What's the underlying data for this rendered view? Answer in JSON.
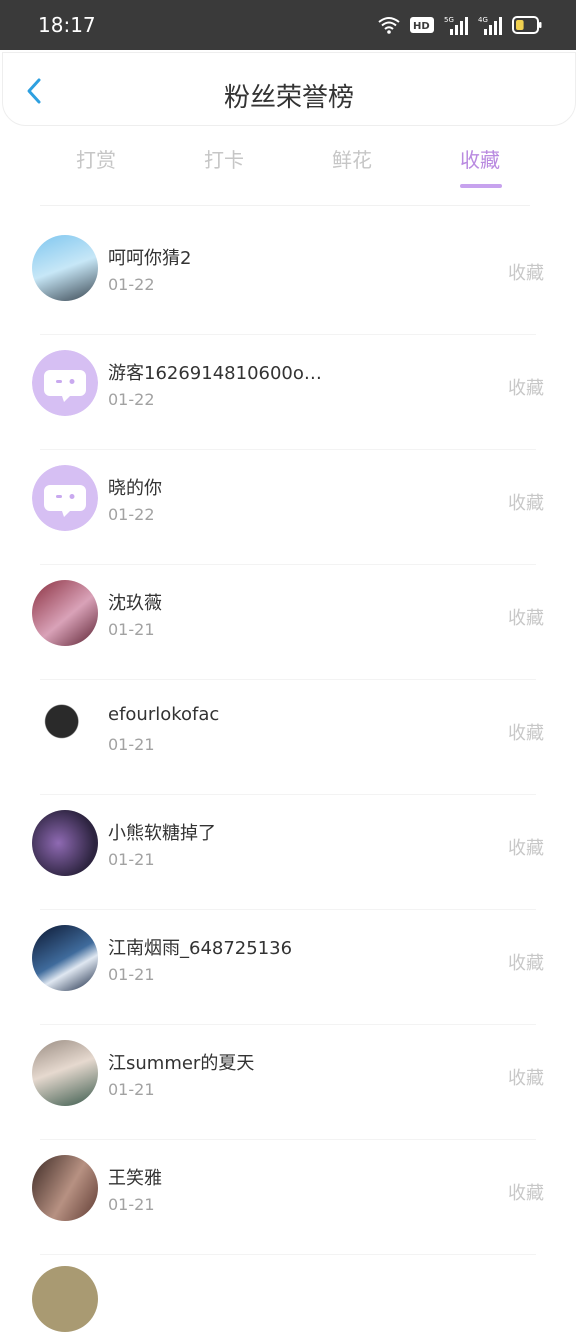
{
  "status_bar": {
    "time": "18:17",
    "hd_badge": "HD",
    "net_labels": [
      "5G",
      "4G"
    ],
    "battery_level": 0.4
  },
  "header": {
    "back_icon": "chevron-left-icon",
    "title": "粉丝荣誉榜"
  },
  "tabs": [
    {
      "label": "打赏",
      "active": false
    },
    {
      "label": "打卡",
      "active": false
    },
    {
      "label": "鲜花",
      "active": false
    },
    {
      "label": "收藏",
      "active": true
    }
  ],
  "colors": {
    "accent": "#b98ae0",
    "default_avatar": "#d6bff3"
  },
  "fans": [
    {
      "name": "呵呵你猜2",
      "date": "01-22",
      "action": "收藏",
      "avatar": "photo"
    },
    {
      "name": "游客1626914810600on...",
      "date": "01-22",
      "action": "收藏",
      "avatar": "default-chat-icon"
    },
    {
      "name": "晓的你",
      "date": "01-22",
      "action": "收藏",
      "avatar": "default-chat-icon"
    },
    {
      "name": "沈玖薇",
      "date": "01-21",
      "action": "收藏",
      "avatar": "photo"
    },
    {
      "name": "efourlokofac",
      "date": "01-21",
      "action": "收藏",
      "avatar": "photo"
    },
    {
      "name": "小熊软糖掉了",
      "date": "01-21",
      "action": "收藏",
      "avatar": "photo"
    },
    {
      "name": "江南烟雨_648725136",
      "date": "01-21",
      "action": "收藏",
      "avatar": "photo"
    },
    {
      "name": "江summer的夏天",
      "date": "01-21",
      "action": "收藏",
      "avatar": "photo"
    },
    {
      "name": "王笑雅",
      "date": "01-21",
      "action": "收藏",
      "avatar": "photo"
    }
  ]
}
